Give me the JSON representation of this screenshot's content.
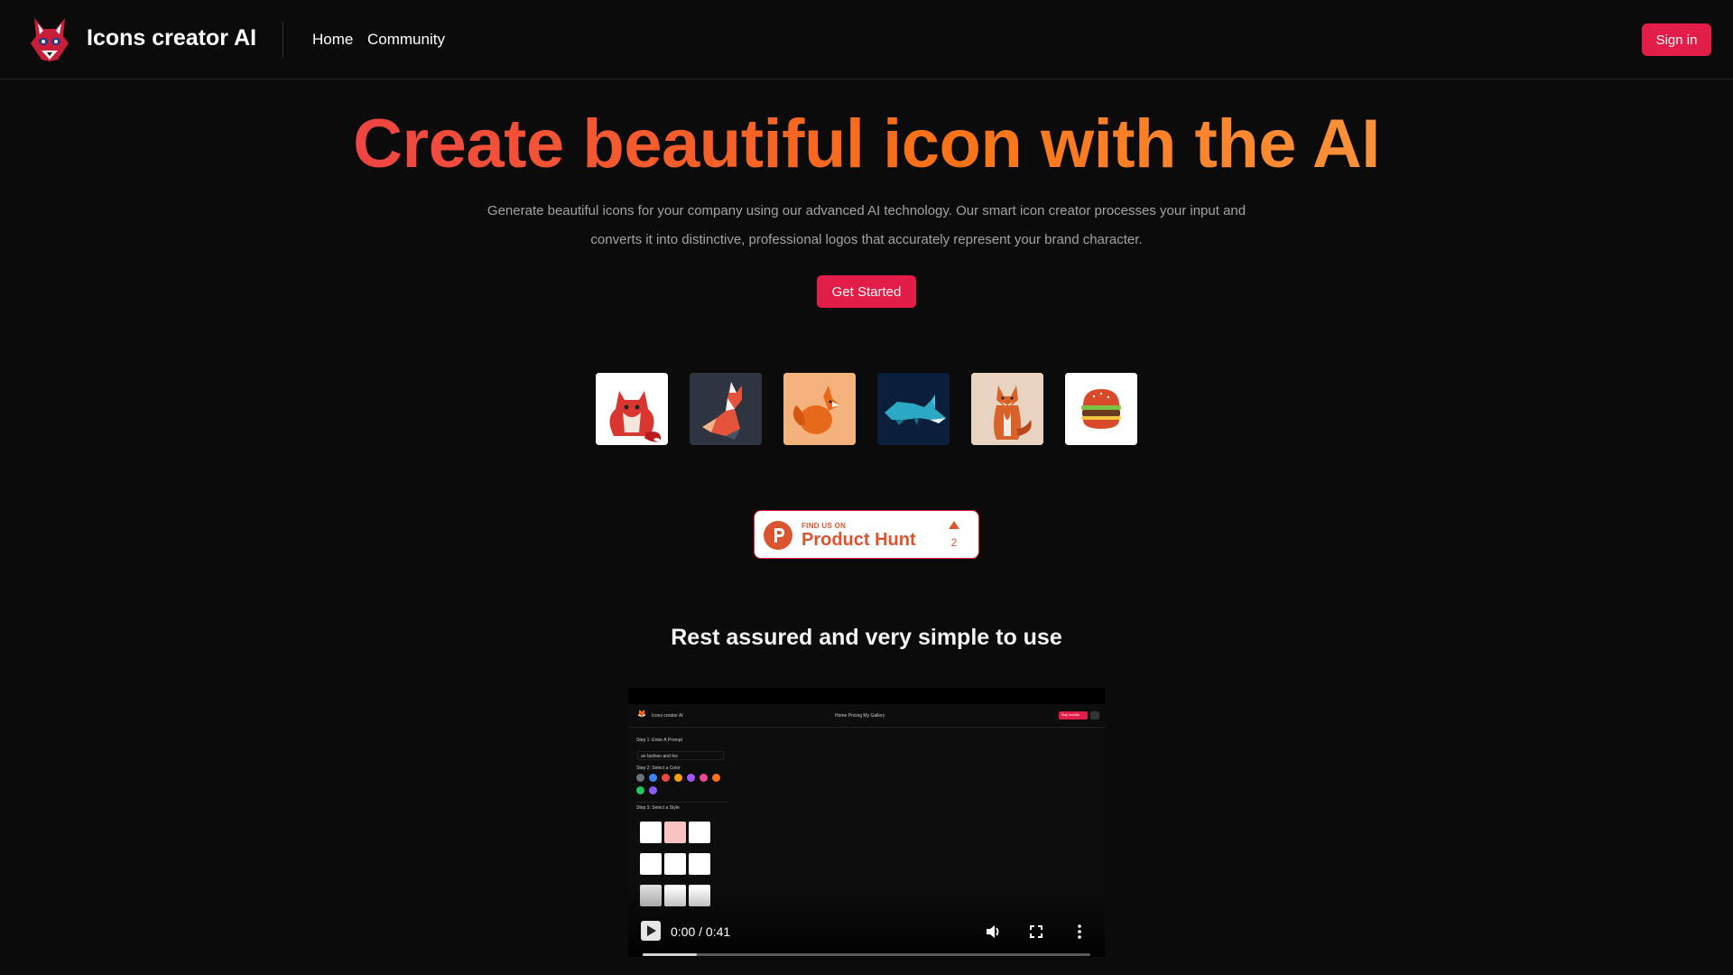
{
  "header": {
    "brand": "Icons creator AI",
    "logo_icon": "fox-head-logo-icon",
    "nav": [
      {
        "label": "Home"
      },
      {
        "label": "Community"
      }
    ],
    "signin_label": "Sign in"
  },
  "hero": {
    "title": "Create beautiful icon with the AI",
    "description": "Generate beautiful icons for your company using our advanced AI technology. Our smart icon creator processes your input and converts it into distinctive, professional logos that accurately represent your brand character.",
    "cta_label": "Get Started"
  },
  "gallery": [
    {
      "name": "red-fox-cartoon-icon",
      "bg": "#ffffff"
    },
    {
      "name": "polygon-fox-icon",
      "bg": "#2e3440"
    },
    {
      "name": "orange-fox-icon",
      "bg": "#f4b37c"
    },
    {
      "name": "blue-fox-icon",
      "bg": "#0b1e3a"
    },
    {
      "name": "sitting-fox-icon",
      "bg": "#e7d3c0"
    },
    {
      "name": "burger-icon",
      "bg": "#ffffff"
    }
  ],
  "product_hunt": {
    "find_label": "FIND US ON",
    "name": "Product Hunt",
    "upvotes": "2"
  },
  "section": {
    "title": "Rest assured and very simple to use"
  },
  "video": {
    "time": "0:00 / 0:41",
    "progress": 0.12,
    "preview": {
      "brand": "Icons creator AI",
      "nav": "Home   Pricing   My Gallery",
      "step1": "Step 1: Enter A Prompt",
      "prompt_value": "an fashion and fox",
      "step2": "Step 2: Select a Color",
      "step3": "Step 3: Select a Style",
      "buy_label": "Buy credits",
      "colors": [
        "#6b7280",
        "#3b82f6",
        "#ef4444",
        "#f59e0b",
        "#a855f7",
        "#ec4899",
        "#f97316",
        "#22c55e",
        "#8b5cf6"
      ]
    }
  },
  "colors": {
    "accent": "#e11d48",
    "background": "#0b0b0b",
    "title_gradient_start": "#ef4444",
    "title_gradient_end": "#fb923c"
  }
}
